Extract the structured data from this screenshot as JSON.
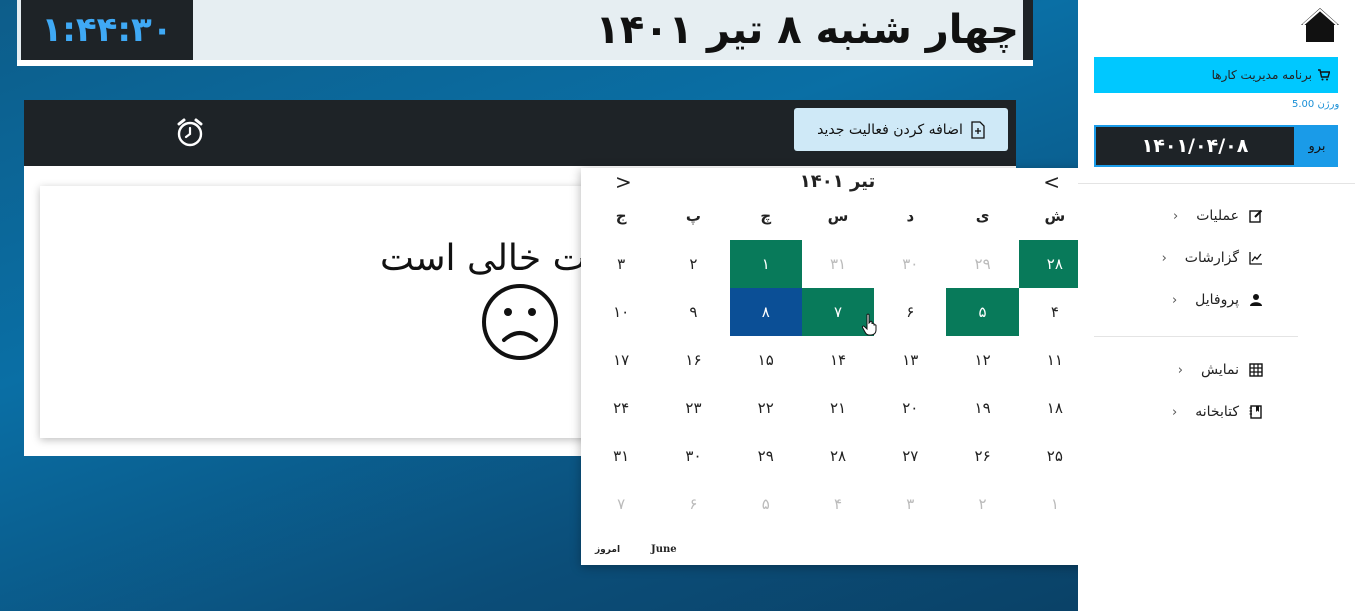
{
  "header": {
    "clock": "۱:۴۴:۳۰",
    "date_title": "چهار شنبه ۸ تیر ۱۴۰۱"
  },
  "panel": {
    "add_button_label": "اضافه کردن فعالیت جدید",
    "empty_message": "ت خالی است"
  },
  "calendar": {
    "month_title": "تیر ۱۴۰۱",
    "prev_symbol": "<",
    "next_symbol": ">",
    "weekdays": [
      "ش",
      "ی",
      "د",
      "س",
      "چ",
      "پ",
      "ج"
    ],
    "weeks": [
      [
        {
          "d": "۲۸",
          "s": "hl"
        },
        {
          "d": "۲۹",
          "s": "muted"
        },
        {
          "d": "۳۰",
          "s": "muted"
        },
        {
          "d": "۳۱",
          "s": "muted"
        },
        {
          "d": "۱",
          "s": "hl"
        },
        {
          "d": "۲",
          "s": ""
        },
        {
          "d": "۳",
          "s": ""
        }
      ],
      [
        {
          "d": "۴",
          "s": ""
        },
        {
          "d": "۵",
          "s": "hl"
        },
        {
          "d": "۶",
          "s": ""
        },
        {
          "d": "۷",
          "s": "hl"
        },
        {
          "d": "۸",
          "s": "sel"
        },
        {
          "d": "۹",
          "s": ""
        },
        {
          "d": "۱۰",
          "s": ""
        }
      ],
      [
        {
          "d": "۱۱",
          "s": ""
        },
        {
          "d": "۱۲",
          "s": ""
        },
        {
          "d": "۱۳",
          "s": ""
        },
        {
          "d": "۱۴",
          "s": ""
        },
        {
          "d": "۱۵",
          "s": ""
        },
        {
          "d": "۱۶",
          "s": ""
        },
        {
          "d": "۱۷",
          "s": ""
        }
      ],
      [
        {
          "d": "۱۸",
          "s": ""
        },
        {
          "d": "۱۹",
          "s": ""
        },
        {
          "d": "۲۰",
          "s": ""
        },
        {
          "d": "۲۱",
          "s": ""
        },
        {
          "d": "۲۲",
          "s": ""
        },
        {
          "d": "۲۳",
          "s": ""
        },
        {
          "d": "۲۴",
          "s": ""
        }
      ],
      [
        {
          "d": "۲۵",
          "s": ""
        },
        {
          "d": "۲۶",
          "s": ""
        },
        {
          "d": "۲۷",
          "s": ""
        },
        {
          "d": "۲۸",
          "s": ""
        },
        {
          "d": "۲۹",
          "s": ""
        },
        {
          "d": "۳۰",
          "s": ""
        },
        {
          "d": "۳۱",
          "s": ""
        }
      ],
      [
        {
          "d": "۱",
          "s": "muted"
        },
        {
          "d": "۲",
          "s": "muted"
        },
        {
          "d": "۳",
          "s": "muted"
        },
        {
          "d": "۴",
          "s": "muted"
        },
        {
          "d": "۵",
          "s": "muted"
        },
        {
          "d": "۶",
          "s": "muted"
        },
        {
          "d": "۷",
          "s": "muted"
        }
      ]
    ],
    "today_label": "امروز",
    "gregorian_month": "June"
  },
  "sidebar": {
    "app_title": "برنامه مدیریت کارها",
    "version": "ورژن 5.00",
    "go_label": "برو",
    "date_value": "۱۴۰۱/۰۴/۰۸",
    "nav_group1": [
      {
        "label": "عملیات",
        "icon": "edit-icon"
      },
      {
        "label": "گزارشات",
        "icon": "chart-icon"
      },
      {
        "label": "پروفایل",
        "icon": "user-icon"
      }
    ],
    "nav_group2": [
      {
        "label": "نمایش",
        "icon": "table-icon"
      },
      {
        "label": "کتابخانه",
        "icon": "book-icon"
      }
    ]
  },
  "colors": {
    "accent_cyan": "#00c8ff",
    "clock_blue": "#3fa9f5",
    "highlight_green": "#087a5a",
    "selected_blue": "#0b4f96",
    "dark_bar": "#1e2327"
  }
}
